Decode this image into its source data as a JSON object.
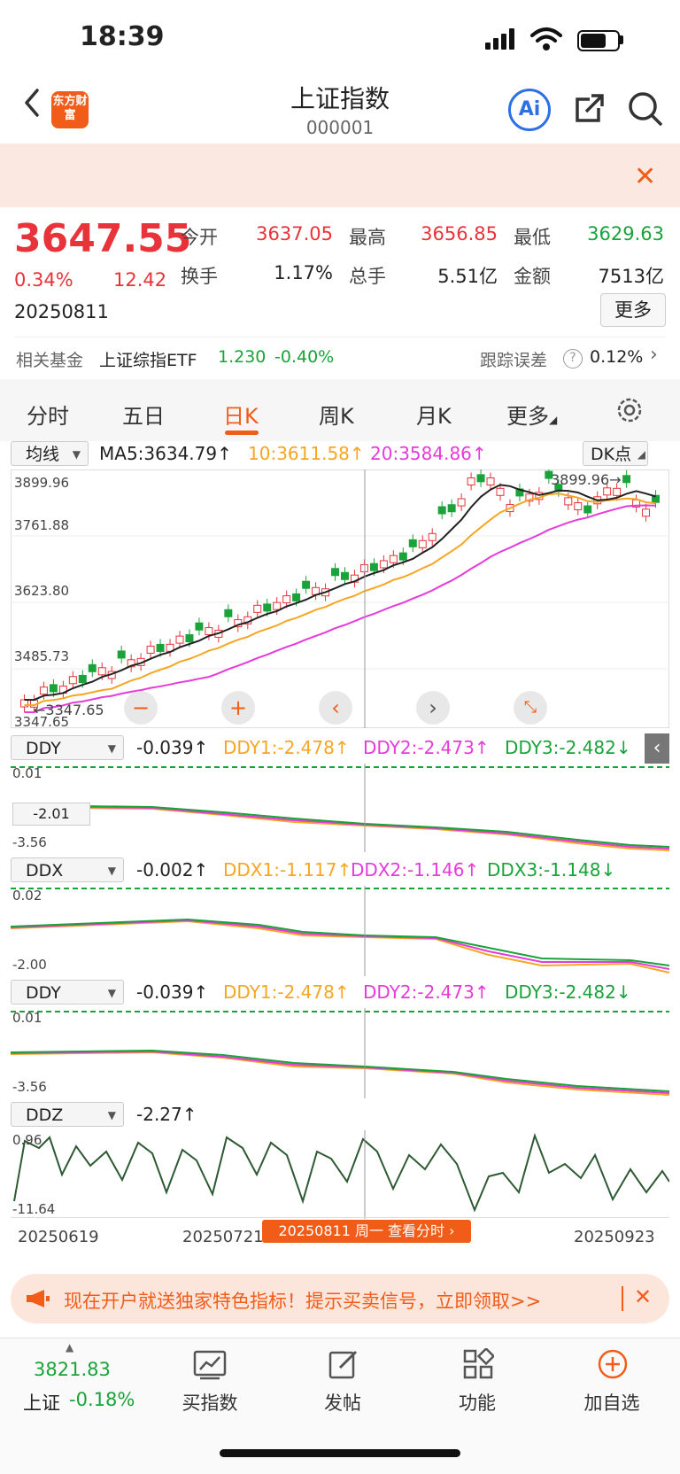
{
  "status": {
    "time": "18:39"
  },
  "header": {
    "logo": "东方财富",
    "title": "上证指数",
    "code": "000001",
    "ai_label": "Ai"
  },
  "quote": {
    "price": "3647.55",
    "pct": "0.34%",
    "change": "12.42",
    "date": "20250811",
    "open_label": "今开",
    "open": "3637.05",
    "high_label": "最高",
    "high": "3656.85",
    "low_label": "最低",
    "low": "3629.63",
    "turnover_label": "换手",
    "turnover": "1.17%",
    "vol_label": "总手",
    "vol": "5.51亿",
    "amount_label": "金额",
    "amount": "7513亿",
    "more": "更多"
  },
  "fund": {
    "label": "相关基金",
    "name": "上证综指ETF",
    "price": "1.230",
    "pct": "-0.40%",
    "err_label": "跟踪误差",
    "err": "0.12%"
  },
  "tabs": [
    "分时",
    "五日",
    "日K",
    "周K",
    "月K",
    "更多"
  ],
  "kline": {
    "ma_select": "均线",
    "dk_select": "DK点",
    "ma5": "MA5:3634.79↑",
    "ma10": "10:3611.58↑",
    "ma20": "20:3584.86↑",
    "y_labels": [
      "3899.96",
      "3761.88",
      "3623.80",
      "3485.73",
      "3347.65"
    ],
    "max_mark": "3899.96→",
    "min_mark": "←3347.65"
  },
  "ddy1": {
    "select": "DDY",
    "val": "-0.039↑",
    "d1": "DDY1:-2.478↑",
    "d2": "DDY2:-2.473↑",
    "d3": "DDY3:-2.482↓",
    "top": "0.01",
    "bottom": "-3.56",
    "cursor": "-2.01"
  },
  "ddx": {
    "select": "DDX",
    "val": "-0.002↑",
    "d1": "DDX1:-1.117↑",
    "d2": "DDX2:-1.146↑",
    "d3": "DDX3:-1.148↓",
    "top": "0.02",
    "bottom": "-2.00"
  },
  "ddy2": {
    "select": "DDY",
    "val": "-0.039↑",
    "d1": "DDY1:-2.478↑",
    "d2": "DDY2:-2.473↑",
    "d3": "DDY3:-2.482↓",
    "top": "0.01",
    "bottom": "-3.56"
  },
  "ddz": {
    "select": "DDZ",
    "val": "-2.27↑",
    "top": "0.96",
    "bottom": "-11.64"
  },
  "xaxis": {
    "d1": "20250619",
    "d2": "20250721",
    "d3": "20250923",
    "pill": "20250811 周一 查看分时"
  },
  "promo": {
    "text": "现在开户就送独家特色指标！提示买卖信号，立即领取>>"
  },
  "bottom": {
    "idx_val": "3821.83",
    "idx_name": "上证",
    "idx_pct": "-0.18%",
    "b1": "买指数",
    "b2": "发帖",
    "b3": "功能",
    "b4": "加自选"
  }
}
